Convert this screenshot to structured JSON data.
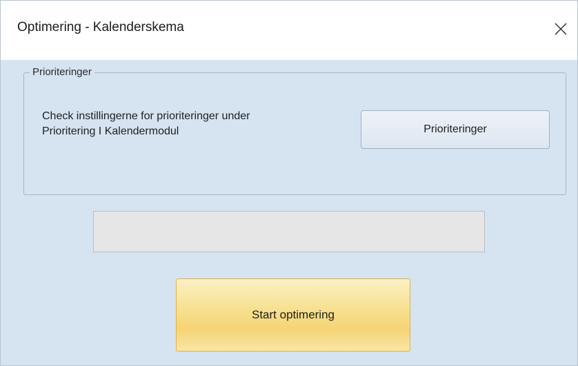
{
  "window": {
    "title": "Optimering - Kalenderskema"
  },
  "group": {
    "legend": "Prioriteringer",
    "info_line1": "Check instillingerne for prioriteringer under",
    "info_line2": "Prioritering I Kalendermodul",
    "button_label": "Prioriteringer"
  },
  "progress": {
    "value_percent": 0
  },
  "actions": {
    "start_label": "Start optimering"
  },
  "colors": {
    "background": "#d6e3f1",
    "start_button": "#f7df8c",
    "progress_track": "#e6e6e6"
  },
  "icons": {
    "close": "close-icon"
  }
}
